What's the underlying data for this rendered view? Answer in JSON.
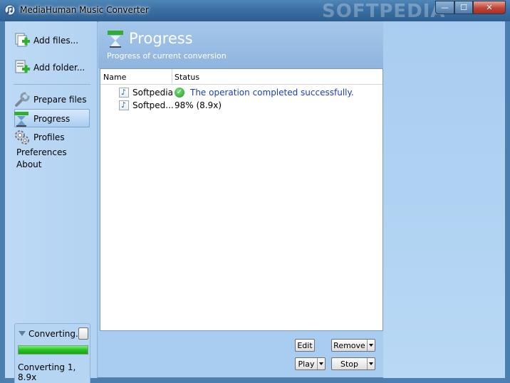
{
  "window": {
    "title": "MediaHuman Music Converter",
    "watermark": "SOFTPEDIA",
    "controls": {
      "minimize": "—",
      "maximize": "☐",
      "close": "✕"
    }
  },
  "sidebar": {
    "actions": [
      {
        "label": "Add files...",
        "icon": "add-files-icon"
      },
      {
        "label": "Add folder...",
        "icon": "add-folder-icon"
      }
    ],
    "nav": [
      {
        "label": "Prepare files",
        "icon": "wrench-icon"
      },
      {
        "label": "Progress",
        "icon": "hourglass-icon",
        "selected": true
      },
      {
        "label": "Profiles",
        "icon": "gear-icon"
      }
    ],
    "links": [
      "Preferences",
      "About"
    ]
  },
  "converting": {
    "title": "Converting...",
    "progress_fraction": 1.0,
    "status": "Converting 1, 8.9x"
  },
  "content": {
    "title": "Progress",
    "subtitle": "Progress of current conversion",
    "columns": {
      "name": "Name",
      "status": "Status"
    },
    "rows": [
      {
        "name": "Softpedia",
        "status": "The operation completed successfully.",
        "done": true
      },
      {
        "name": "Softped...",
        "status": "98% (8.9x)",
        "done": false
      }
    ]
  },
  "buttons": {
    "edit": "Edit",
    "remove": "Remove",
    "play": "Play",
    "stop": "Stop"
  },
  "colors": {
    "accent": "#1a3fb5",
    "progress": "#24c224"
  }
}
